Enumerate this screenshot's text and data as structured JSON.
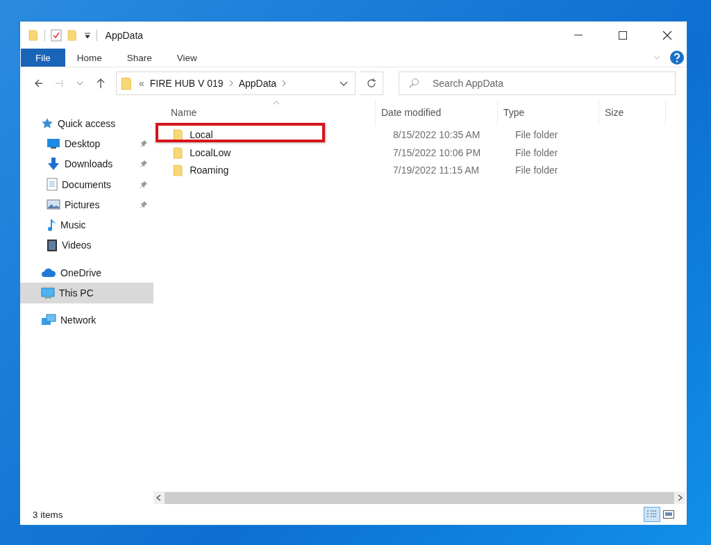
{
  "window": {
    "title": "AppData"
  },
  "ribbon_tabs": [
    {
      "label": "File",
      "kind": "menu"
    },
    {
      "label": "Home",
      "kind": "tab"
    },
    {
      "label": "Share",
      "kind": "tab"
    },
    {
      "label": "View",
      "kind": "tab"
    }
  ],
  "address": {
    "overflow": "«",
    "path": [
      "FIRE HUB V 019",
      "AppData"
    ]
  },
  "search": {
    "placeholder": "Search AppData"
  },
  "navigation": [
    {
      "label": "Quick access",
      "selected": false,
      "children": [
        {
          "label": "Desktop",
          "pinned": true,
          "selected": false
        },
        {
          "label": "Downloads",
          "pinned": true,
          "selected": false
        },
        {
          "label": "Documents",
          "pinned": true,
          "selected": false
        },
        {
          "label": "Pictures",
          "pinned": true,
          "selected": false
        },
        {
          "label": "Music",
          "pinned": false,
          "selected": false
        },
        {
          "label": "Videos",
          "pinned": false,
          "selected": false
        }
      ]
    },
    {
      "label": "OneDrive",
      "selected": false
    },
    {
      "label": "This PC",
      "selected": true
    },
    {
      "label": "Network",
      "selected": false
    }
  ],
  "table": {
    "columns": [
      {
        "label": "Name",
        "sorted": true
      },
      {
        "label": "Date modified",
        "sorted": false
      },
      {
        "label": "Type",
        "sorted": false
      },
      {
        "label": "Size",
        "sorted": false
      }
    ],
    "rows": [
      {
        "name": "Local",
        "date": "8/15/2022 10:35 AM",
        "type": "File folder",
        "highlighted": true
      },
      {
        "name": "LocalLow",
        "date": "7/15/2022 10:06 PM",
        "type": "File folder",
        "highlighted": false
      },
      {
        "name": "Roaming",
        "date": "7/19/2022 11:15 AM",
        "type": "File folder",
        "highlighted": false
      }
    ]
  },
  "status_bar": {
    "count": "3 items",
    "views": [
      {
        "kind": "details",
        "selected": true
      },
      {
        "kind": "large-icons",
        "selected": false
      }
    ]
  }
}
